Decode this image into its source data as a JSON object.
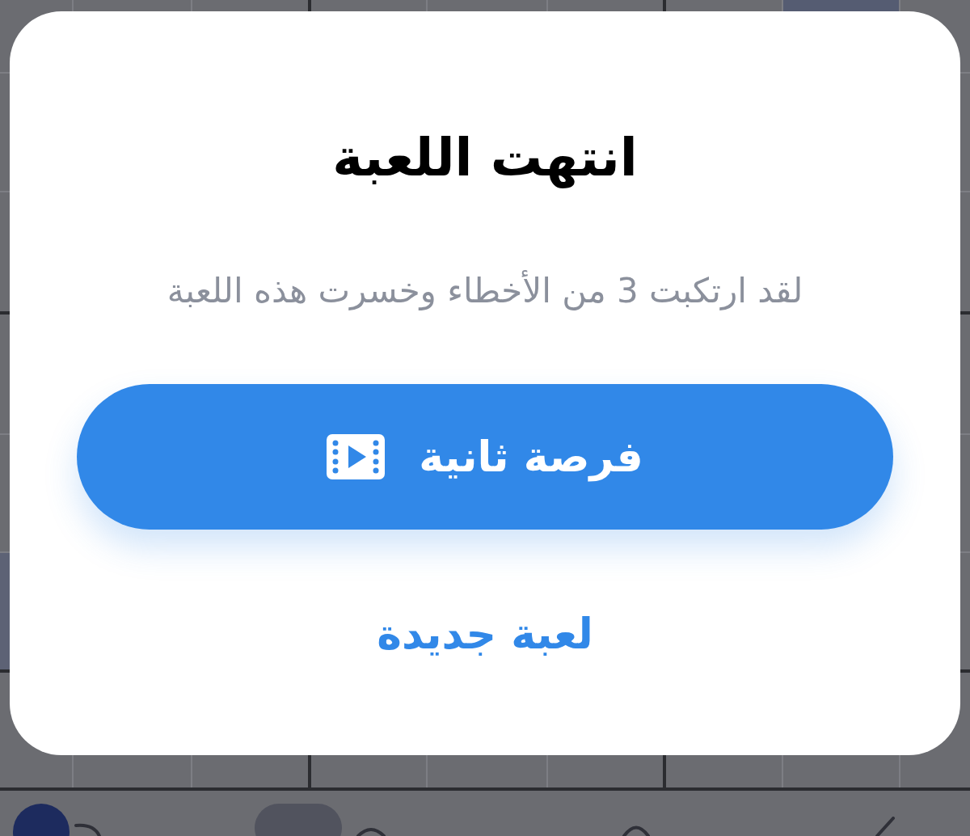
{
  "dialog": {
    "title": "انتهت اللعبة",
    "message": "لقد ارتكبت 3 من الأخطاء وخسرت هذه اللعبة",
    "primary_button": {
      "label": "فرصة ثانية"
    },
    "secondary_link": {
      "label": "لعبة جديدة"
    }
  }
}
